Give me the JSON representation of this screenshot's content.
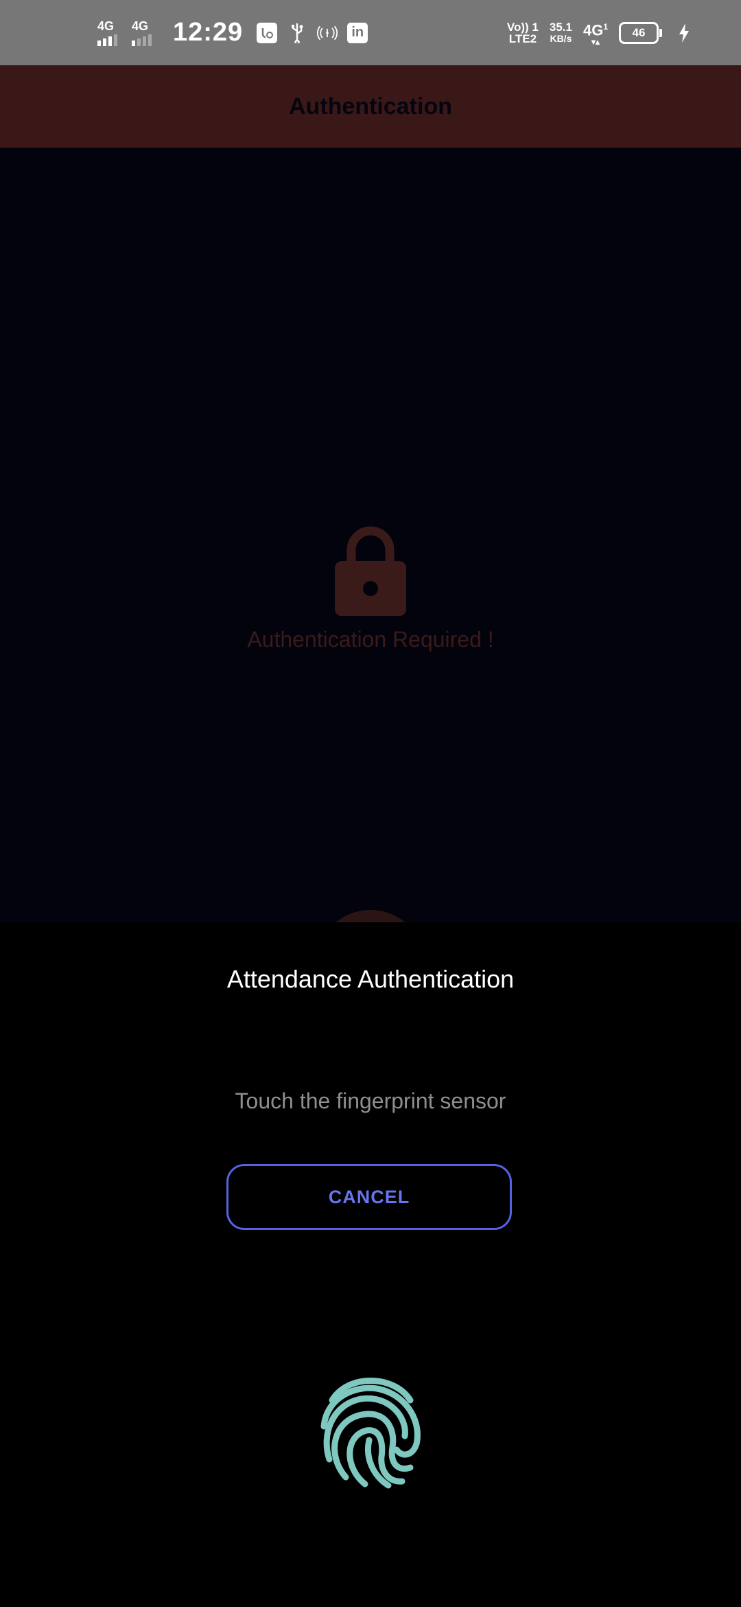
{
  "status_bar": {
    "sim1_label": "4G",
    "sim2_label": "4G",
    "time": "12:29",
    "volte_label": "Vo)) 1",
    "lte_label": "LTE2",
    "speed_value": "35.1",
    "speed_unit": "KB/s",
    "network_label": "4G",
    "network_sub": "1",
    "battery_level": "46",
    "icons": [
      "signal-icon",
      "signal-icon",
      "app-notification-icon",
      "usb-icon",
      "hotspot-icon",
      "linkedin-icon",
      "battery-icon",
      "charging-icon"
    ]
  },
  "app_bar": {
    "title": "Authentication"
  },
  "content": {
    "lock_icon": "lock-icon",
    "message": "Authentication Required !"
  },
  "dialog": {
    "title": "Attendance Authentication",
    "subtitle": "Touch the fingerprint sensor",
    "cancel_label": "CANCEL",
    "fingerprint_icon": "fingerprint-icon"
  },
  "colors": {
    "status_bar": "#777777",
    "app_bar": "#3a1818",
    "content_bg": "#03030d",
    "accent": "#5562e6",
    "fingerprint": "#7ec8c0"
  }
}
